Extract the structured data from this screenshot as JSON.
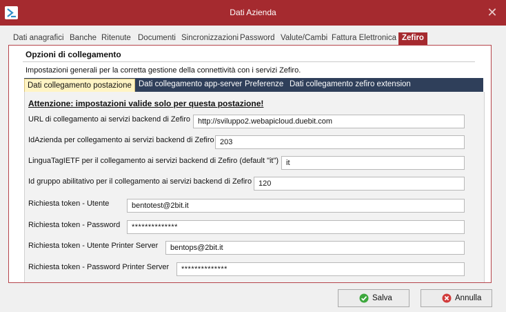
{
  "window": {
    "title": "Dati Azienda",
    "close_glyph": "✕"
  },
  "tabs": [
    {
      "label": "Dati anagrafici"
    },
    {
      "label": "Banche"
    },
    {
      "label": "Ritenute"
    },
    {
      "label": "Documenti"
    },
    {
      "label": "Sincronizzazioni"
    },
    {
      "label": "Password"
    },
    {
      "label": "Valute/Cambi"
    },
    {
      "label": "Fattura Elettronica"
    },
    {
      "label": "Zefiro"
    }
  ],
  "active_tab": "Zefiro",
  "section": {
    "title": "Opzioni di collegamento",
    "description": "Impostazioni generali per la corretta gestione della connettività con i servizi Zefiro."
  },
  "inner_tabs": [
    {
      "label": "Dati collegamento postazione"
    },
    {
      "label": "Dati collegamento app-server"
    },
    {
      "label": "Preferenze"
    },
    {
      "label": "Dati collegamento zefiro extension"
    }
  ],
  "warning": "Attenzione: impostazioni valide solo per questa postazione!",
  "fields": {
    "url": {
      "label": "URL di collegamento ai servizi backend di Zefiro",
      "value": "http://sviluppo2.webapicloud.duebit.com"
    },
    "id_azienda": {
      "label": "IdAzienda per collegamento ai servizi backend di Zefiro",
      "value": "203"
    },
    "lingua": {
      "label": "LinguaTagIETF per il collegamento ai servizi backend di Zefiro (default \"it\")",
      "value": "it"
    },
    "id_gruppo": {
      "label": "Id gruppo abilitativo per il collegamento ai servizi backend di Zefiro",
      "value": "120"
    },
    "utente": {
      "label": "Richiesta token - Utente",
      "value": "bentotest@2bit.it"
    },
    "password": {
      "label": "Richiesta token - Password",
      "value": "**************"
    },
    "utente_printer": {
      "label": "Richiesta token - Utente Printer Server",
      "value": "bentops@2bit.it"
    },
    "password_printer": {
      "label": "Richiesta token - Password Printer Server",
      "value": "**************"
    }
  },
  "buttons": {
    "save": "Salva",
    "cancel": "Annulla"
  },
  "colors": {
    "titlebar": "#a52a2f",
    "inner_tabbar": "#2f3f5a",
    "active_inner_tab": "#fff4c4"
  }
}
